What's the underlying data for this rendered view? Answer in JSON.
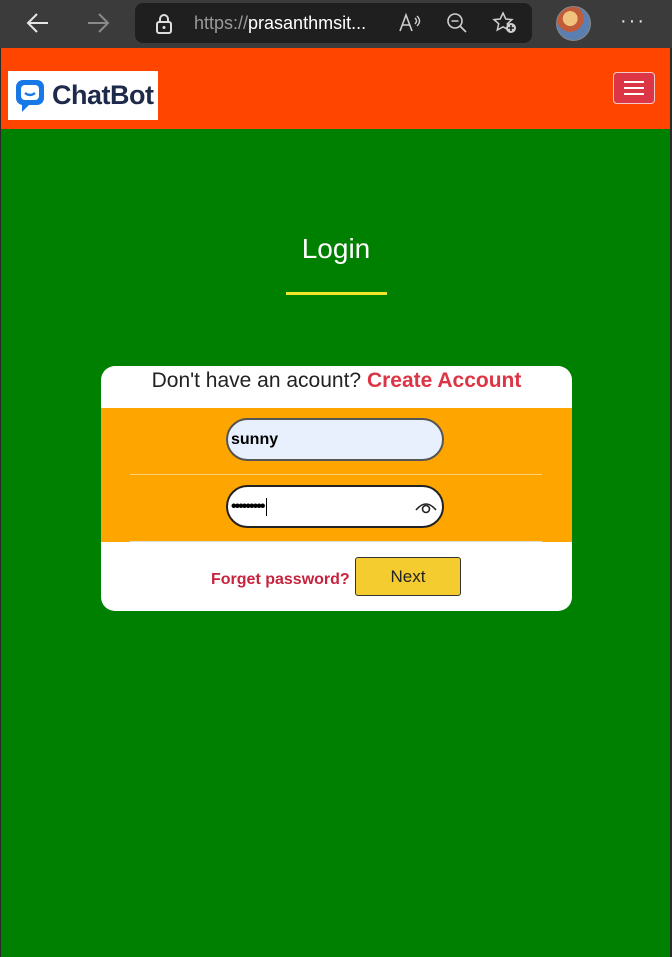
{
  "browser": {
    "url_scheme": "https://",
    "url_host": "prasanthmsit...",
    "more_label": "···"
  },
  "navbar": {
    "brand": "ChatBot",
    "brand_color": "#ff4500"
  },
  "login": {
    "title": "Login",
    "signup_prompt": "Don't have an acount?",
    "signup_link": "Create Account",
    "username_value": "sunny",
    "password_value": "•••••••••",
    "forget_label": "Forget password?",
    "next_label": "Next"
  },
  "colors": {
    "background": "#008000",
    "form_band": "#ffa500",
    "button": "#f5cc2f",
    "link": "#dc3545"
  }
}
